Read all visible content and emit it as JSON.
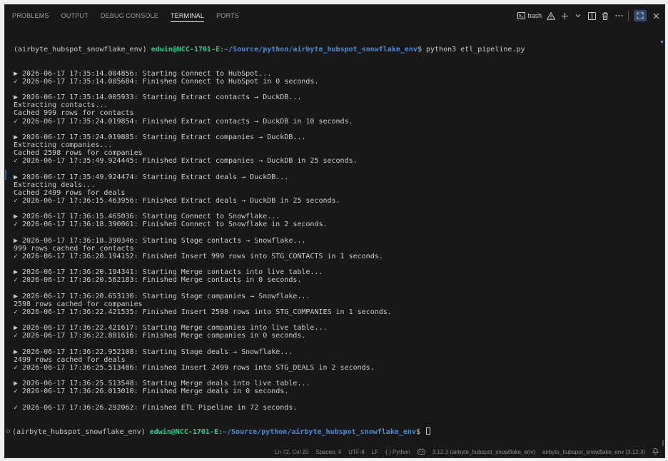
{
  "tabs": [
    {
      "label": "PROBLEMS",
      "active": false
    },
    {
      "label": "OUTPUT",
      "active": false
    },
    {
      "label": "DEBUG CONSOLE",
      "active": false
    },
    {
      "label": "TERMINAL",
      "active": true
    },
    {
      "label": "PORTS",
      "active": false
    }
  ],
  "toolbar": {
    "shell_label": "bash",
    "warning_icon": "warning-icon",
    "add_icon": "plus-icon",
    "dropdown_icon": "chevron-down-icon",
    "split_icon": "split-terminal-icon",
    "trash_icon": "trash-icon",
    "more_icon": "more-icon",
    "maximize_icon": "maximize-panel-icon",
    "close_icon": "close-icon"
  },
  "prompt": {
    "env": "(airbyte_hubspot_snowflake_env) ",
    "user": "edwin@NCC-1701-E",
    "colon": ":",
    "path": "~/Source/python/airbyte_hubspot_snowflake_env",
    "suffix": "$ ",
    "command": "python3 etl_pipeline.py"
  },
  "output": [
    "▶ 2026-06-17 17:35:14.004856: Starting Connect to HubSpot...",
    "✓ 2026-06-17 17:35:14.005684: Finished Connect to HubSpot in 0 seconds.",
    "",
    "▶ 2026-06-17 17:35:14.005933: Starting Extract contacts → DuckDB...",
    "Extracting contacts...",
    "Cached 999 rows for contacts",
    "✓ 2026-06-17 17:35:24.019854: Finished Extract contacts → DuckDB in 10 seconds.",
    "",
    "▶ 2026-06-17 17:35:24.019885: Starting Extract companies → DuckDB...",
    "Extracting companies...",
    "Cached 2598 rows for companies",
    "✓ 2026-06-17 17:35:49.924445: Finished Extract companies → DuckDB in 25 seconds.",
    "",
    "▶ 2026-06-17 17:35:49.924474: Starting Extract deals → DuckDB...",
    "Extracting deals...",
    "Cached 2499 rows for deals",
    "✓ 2026-06-17 17:36:15.463956: Finished Extract deals → DuckDB in 25 seconds.",
    "",
    "▶ 2026-06-17 17:36:15.465036: Starting Connect to Snowflake...",
    "✓ 2026-06-17 17:36:18.390061: Finished Connect to Snowflake in 2 seconds.",
    "",
    "▶ 2026-06-17 17:36:18.390346: Starting Stage contacts → Snowflake...",
    "999 rows cached for contacts",
    "✓ 2026-06-17 17:36:20.194152: Finished Insert 999 rows into STG_CONTACTS in 1 seconds.",
    "",
    "▶ 2026-06-17 17:36:20.194341: Starting Merge contacts into live table...",
    "✓ 2026-06-17 17:36:20.562183: Finished Merge contacts in 0 seconds.",
    "",
    "▶ 2026-06-17 17:36:20.653130: Starting Stage companies → Snowflake...",
    "2598 rows cached for companies",
    "✓ 2026-06-17 17:36:22.421535: Finished Insert 2598 rows into STG_COMPANIES in 1 seconds.",
    "",
    "▶ 2026-06-17 17:36:22.421617: Starting Merge companies into live table...",
    "✓ 2026-06-17 17:36:22.881616: Finished Merge companies in 0 seconds.",
    "",
    "▶ 2026-06-17 17:36:22.952108: Starting Stage deals → Snowflake...",
    "2499 rows cached for deals",
    "✓ 2026-06-17 17:36:25.513486: Finished Insert 2499 rows into STG_DEALS in 2 seconds.",
    "",
    "▶ 2026-06-17 17:36:25.513548: Starting Merge deals into live table...",
    "✓ 2026-06-17 17:36:26.013010: Finished Merge deals in 0 seconds.",
    "",
    "✓ 2026-06-17 17:36:26.292062: Finished ETL Pipeline in 72 seconds."
  ],
  "status_bar": {
    "position": "Ln 72, Col 20",
    "spaces": "Spaces: 4",
    "encoding": "UTF-8",
    "eol": "LF",
    "language": "{ } Python",
    "python_version": "3.12.3 (airbyte_hubspot_snowflake_env)",
    "env_name": "airbyte_hubspot_snowflake_env (3.12.3)",
    "bell_icon": "bell-icon",
    "copilot_icon": "copilot-icon"
  }
}
